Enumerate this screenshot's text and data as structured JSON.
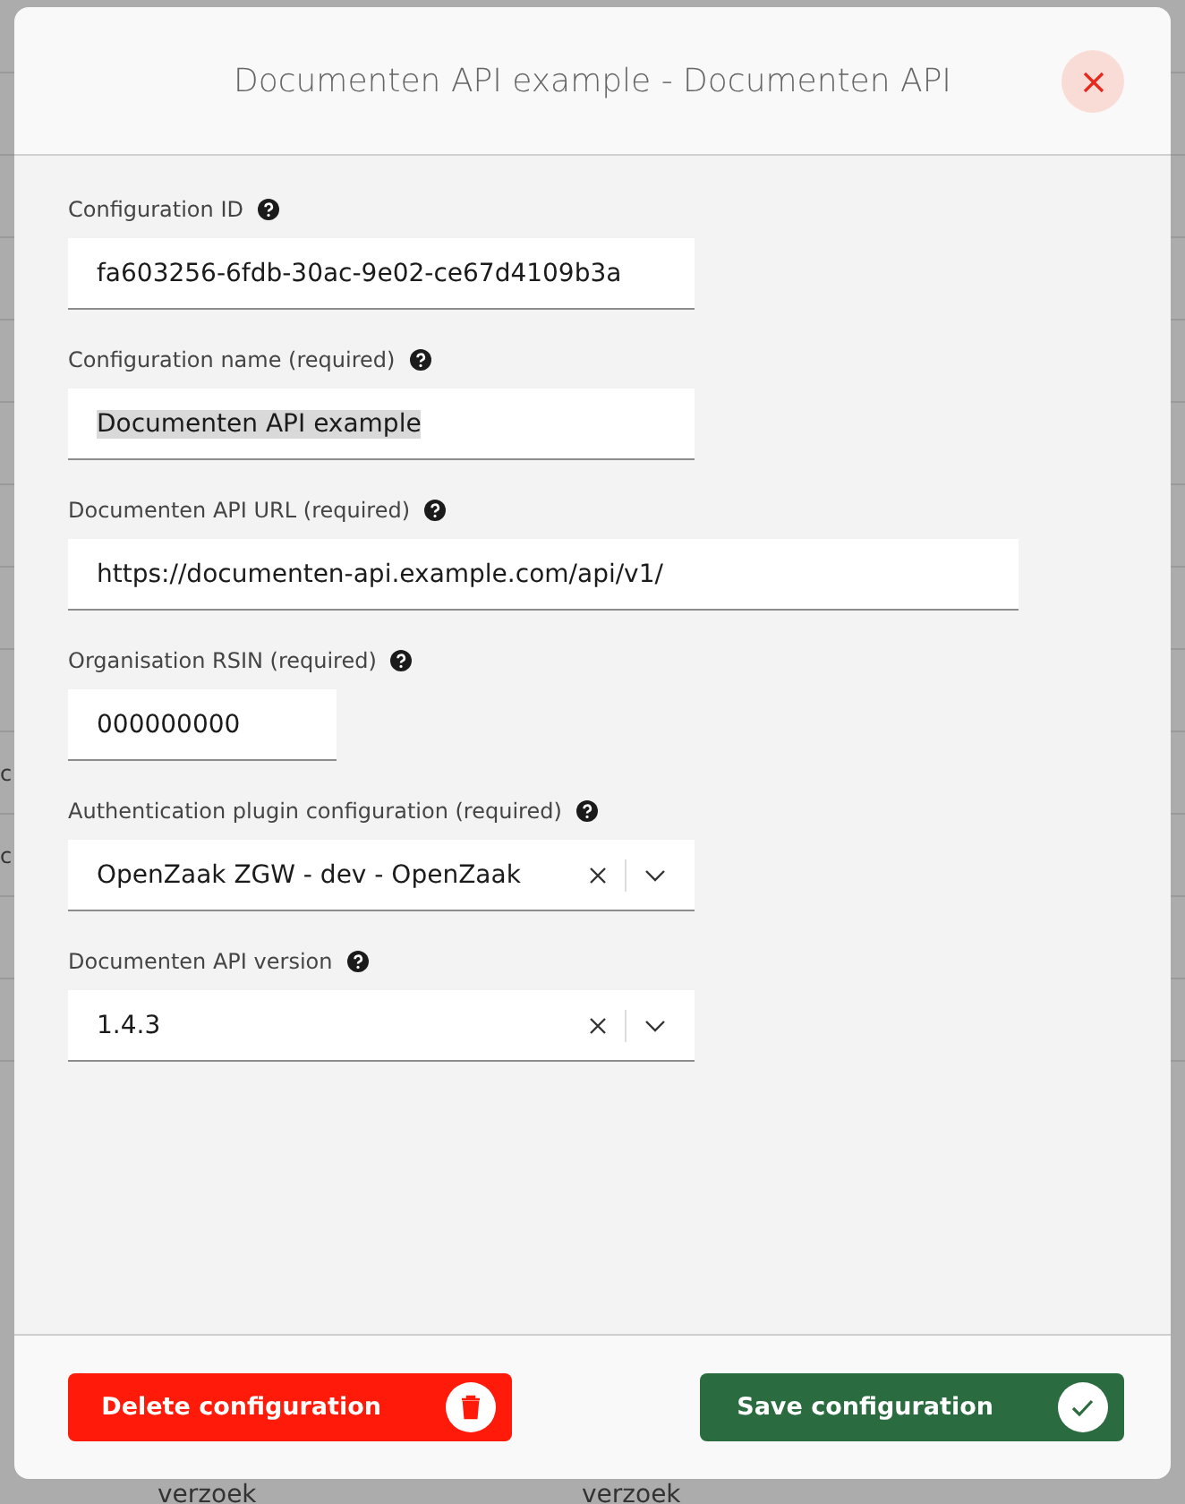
{
  "background": {
    "row_fragments": [
      "c",
      "c"
    ],
    "bottom_cells": [
      "verzoek",
      "verzoek"
    ]
  },
  "dialog": {
    "title": "Documenten API example - Documenten API",
    "fields": [
      {
        "kind": "text",
        "label": "Configuration ID",
        "value": "fa603256-6fdb-30ac-9e02-ce67d4109b3a"
      },
      {
        "kind": "text",
        "label": "Configuration name (required)",
        "value": "Documenten API example",
        "highlighted": true
      },
      {
        "kind": "text",
        "label": "Documenten API URL (required)",
        "value": "https://documenten-api.example.com/api/v1/"
      },
      {
        "kind": "text",
        "label": "Organisation RSIN (required)",
        "value": "000000000"
      },
      {
        "kind": "select",
        "label": "Authentication plugin configuration (required)",
        "value": "OpenZaak ZGW - dev - OpenZaak"
      },
      {
        "kind": "select",
        "label": "Documenten API version",
        "value": "1.4.3"
      }
    ],
    "buttons": [
      {
        "kind": "delete",
        "label": "Delete configuration"
      },
      {
        "kind": "save",
        "label": "Save configuration"
      }
    ]
  }
}
